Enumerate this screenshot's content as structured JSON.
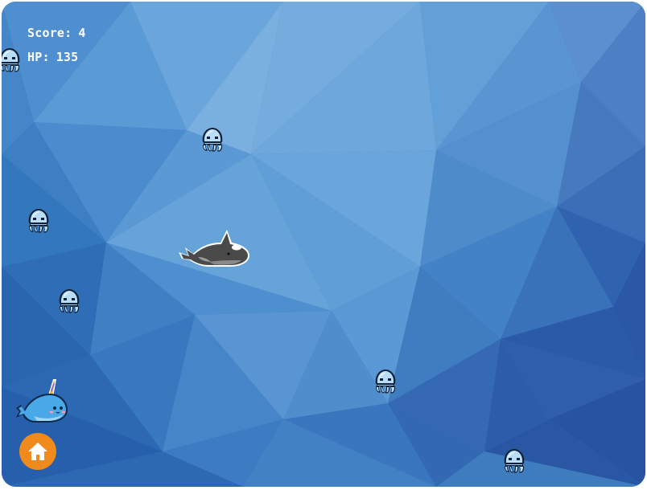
{
  "hud": {
    "score_label": "Score:",
    "score_value": "4",
    "hp_label": "HP:",
    "hp_value": "135"
  },
  "colors": {
    "ocean_base": "#3f7cbe",
    "home_button": "#f08a1c",
    "squid_body": "#b9dcf7",
    "orca_dark": "#4a4a4a",
    "narwhal_body": "#49a8e8"
  },
  "icons": {
    "home": "home-icon",
    "enemy": "squid-icon",
    "boss": "orca-icon",
    "player": "narwhal-icon"
  }
}
